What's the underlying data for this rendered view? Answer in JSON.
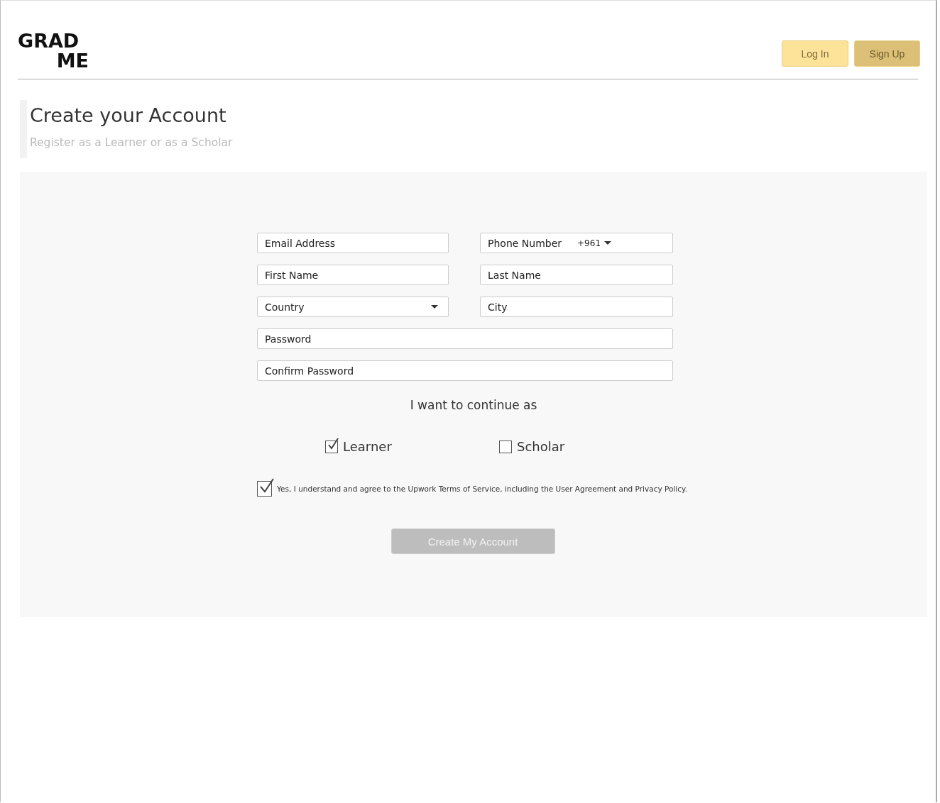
{
  "logo": {
    "line_1": "GRAD",
    "line_2": "ME"
  },
  "nav_buttons": [
    {
      "label": "Log In",
      "selected": false
    },
    {
      "label": "Sign Up",
      "selected": true
    }
  ],
  "heading": {
    "title": "Create your Account",
    "subtitle": "Register as a Learner or as a Scholar"
  },
  "form": {
    "rows": [
      {
        "fields": [
          {
            "kind": "text",
            "placeholder": "Email Address"
          },
          {
            "kind": "phone",
            "placeholder": "Phone Number",
            "code": "+961"
          }
        ]
      },
      {
        "fields": [
          {
            "kind": "text",
            "placeholder": "First Name"
          },
          {
            "kind": "text",
            "placeholder": "Last Name"
          }
        ]
      },
      {
        "fields": [
          {
            "kind": "select",
            "placeholder": "Country"
          },
          {
            "kind": "text",
            "placeholder": "City"
          }
        ]
      },
      {
        "fields": [
          {
            "kind": "text",
            "placeholder": "Password"
          }
        ]
      },
      {
        "fields": [
          {
            "kind": "text",
            "placeholder": "Confirm Password"
          }
        ]
      }
    ],
    "role_prompt": "I want to continue as",
    "roles": [
      {
        "label": "Learner",
        "checked": true
      },
      {
        "label": "Scholar",
        "checked": false
      }
    ],
    "terms": {
      "label": "Yes, I understand and agree to the Upwork Terms of Service, including the User Agreement and Privacy Policy.",
      "checked": true
    },
    "submit": {
      "label": "Create My Account",
      "disabled": true
    }
  }
}
